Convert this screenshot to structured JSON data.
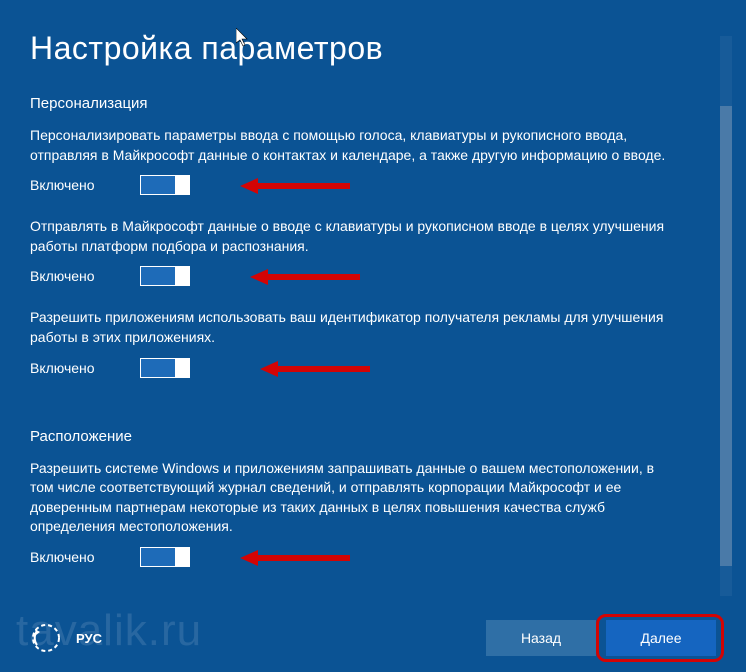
{
  "title": "Настройка параметров",
  "sections": {
    "personalization": {
      "heading": "Персонализация",
      "items": [
        {
          "desc": "Персонализировать параметры ввода с помощью голоса, клавиатуры и рукописного ввода, отправляя в Майкрософт данные о контактах и календаре, а также другую информацию о вводе.",
          "state": "Включено"
        },
        {
          "desc": "Отправлять в Майкрософт данные о вводе с клавиатуры и рукописном вводе в целях улучшения работы платформ подбора и распознания.",
          "state": "Включено"
        },
        {
          "desc": "Разрешить приложениям использовать ваш идентификатор получателя рекламы для улучшения работы в этих приложениях.",
          "state": "Включено"
        }
      ]
    },
    "location": {
      "heading": "Расположение",
      "items": [
        {
          "desc": "Разрешить системе Windows и приложениям запрашивать данные о вашем местоположении, в том числе соответствующий журнал сведений, и отправлять корпорации Майкрософт и ее доверенным партнерам некоторые из таких данных в целях повышения качества служб определения местоположения.",
          "state": "Включено"
        }
      ]
    }
  },
  "footer": {
    "lang": "РУС",
    "back": "Назад",
    "next": "Далее"
  },
  "watermark": "tavalik.ru",
  "colors": {
    "bg": "#0b5394",
    "toggle_track": "#1e6bb8",
    "btn_next": "#1565c0",
    "btn_back": "#2f6fa6",
    "highlight": "#d30404"
  }
}
